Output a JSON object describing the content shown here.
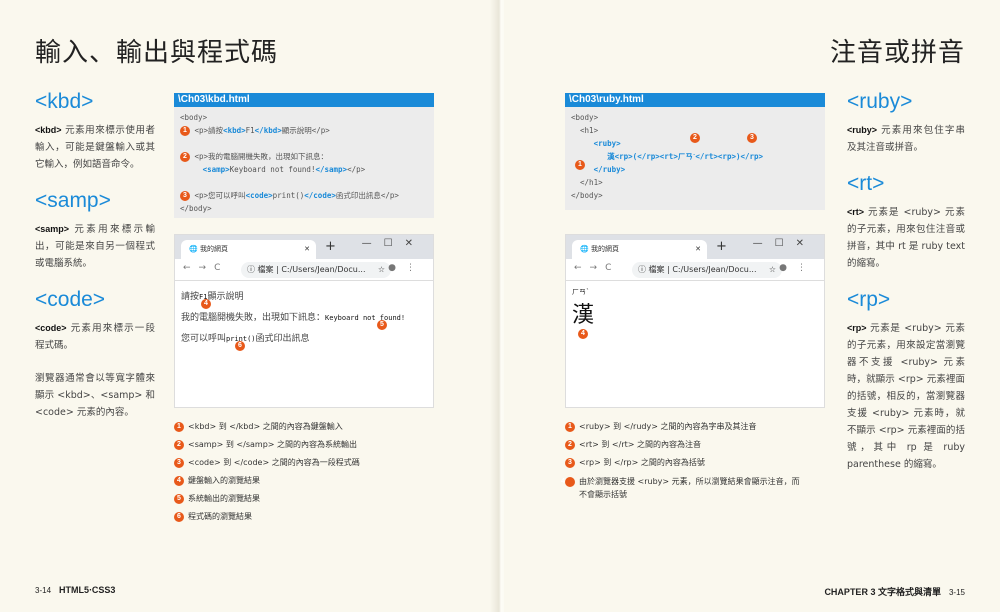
{
  "left": {
    "title": "輸入、輸出與程式碼",
    "sections": [
      {
        "heading": "<kbd>",
        "tag": "<kbd>",
        "text": " 元素用來標示使用者輸入，可能是鍵盤輸入或其它輸入，例如語音命令。"
      },
      {
        "heading": "<samp>",
        "tag": "<samp>",
        "text": " 元素用來標示輸出，可能是來自另一個程式或電腦系統。"
      },
      {
        "heading": "<code>",
        "tag": "<code>",
        "text": " 元素用來標示一段程式碼。"
      }
    ],
    "extra": "瀏覽器通常會以等寬字體來顯示 <kbd>、<samp> 和 <code> 元素的內容。",
    "code": {
      "filename": "\\Ch03\\kbd.html",
      "l0": "<body>",
      "l1a": "<p>請按",
      "l1b": "<kbd>",
      "l1c": "F1",
      "l1d": "</kbd>",
      "l1e": "顯示說明</p>",
      "l2a": "<p>我的電腦開機失敗，出現如下訊息：",
      "l3a": "<samp>",
      "l3b": "Keyboard not found!",
      "l3c": "</samp>",
      "l3d": "</p>",
      "l4a": "<p>您可以呼叫",
      "l4b": "<code>",
      "l4c": "print()",
      "l4d": "</code>",
      "l4e": "函式印出訊息</p>",
      "l5": "</body>"
    },
    "browser": {
      "tab_title": "我的網頁",
      "address_label": "檔案",
      "address": "C:/Users/Jean/Docu...",
      "line1a": "請按",
      "line1b": "F1",
      "line1c": "顯示說明",
      "line2a": "我的電腦開機失敗，出現如下訊息：",
      "line2b": "Keyboard not found!",
      "line3a": "您可以呼叫",
      "line3b": "print()",
      "line3c": "函式印出訊息"
    },
    "notes": [
      "<kbd> 到 </kbd> 之間的內容為鍵盤輸入",
      "<samp> 到 </samp> 之間的內容為系統輸出",
      "<code> 到 </code> 之間的內容為一段程式碼",
      "鍵盤輸入的瀏覽結果",
      "系統輸出的瀏覽結果",
      "程式碼的瀏覽結果"
    ],
    "footer": {
      "page": "3-14",
      "book": "HTML5‧CSS3"
    }
  },
  "right": {
    "title": "注音或拼音",
    "sections": [
      {
        "heading": "<ruby>",
        "tag": "<ruby>",
        "text": " 元素用來包住字串及其注音或拼音。"
      },
      {
        "heading": "<rt>",
        "tag": "<rt>",
        "text": " 元素是 <ruby> 元素的子元素，用來包住注音或拼音，其中 rt 是 ruby text 的縮寫。"
      },
      {
        "heading": "<rp>",
        "tag": "<rp>",
        "text": " 元素是 <ruby> 元素的子元素，用來設定當瀏覽器不支援 <ruby> 元素時，就顯示 <rp> 元素裡面的括號，相反的，當瀏覽器支援 <ruby> 元素時，就不顯示 <rp> 元素裡面的括號，其中 rp 是 ruby parenthese 的縮寫。"
      }
    ],
    "code": {
      "filename": "\\Ch03\\ruby.html",
      "l0": "<body>",
      "l1": "  <h1>",
      "l2": "<ruby>",
      "l3": "漢<rp>(</rp><rt>ㄏㄢˋ</rt><rp>)</rp>",
      "l4": "</ruby>",
      "l5": "  </h1>",
      "l6": "</body>"
    },
    "browser": {
      "tab_title": "我的網頁",
      "address_label": "檔案",
      "address": "C:/Users/Jean/Docu...",
      "ruby_text": "ㄏㄢˋ",
      "base": "漢"
    },
    "notes": [
      "<ruby> 到 </rudy> 之間的內容為字串及其注音",
      "<rt> 到 </rt> 之間的內容為注音",
      "<rp> 到 </rp> 之間的內容為括號",
      "由於瀏覽器支援 <ruby> 元素，所以瀏覽結果會顯示注音，而不會顯示括號"
    ],
    "footer": {
      "chapter": "CHAPTER 3",
      "chapter_title": "文字格式與清單",
      "page": "3-15"
    }
  },
  "numbers": [
    "1",
    "2",
    "3",
    "4",
    "5",
    "6"
  ],
  "colors": {
    "accent": "#1a8ad8",
    "marker": "#e8591a",
    "page": "#faf8ee"
  }
}
